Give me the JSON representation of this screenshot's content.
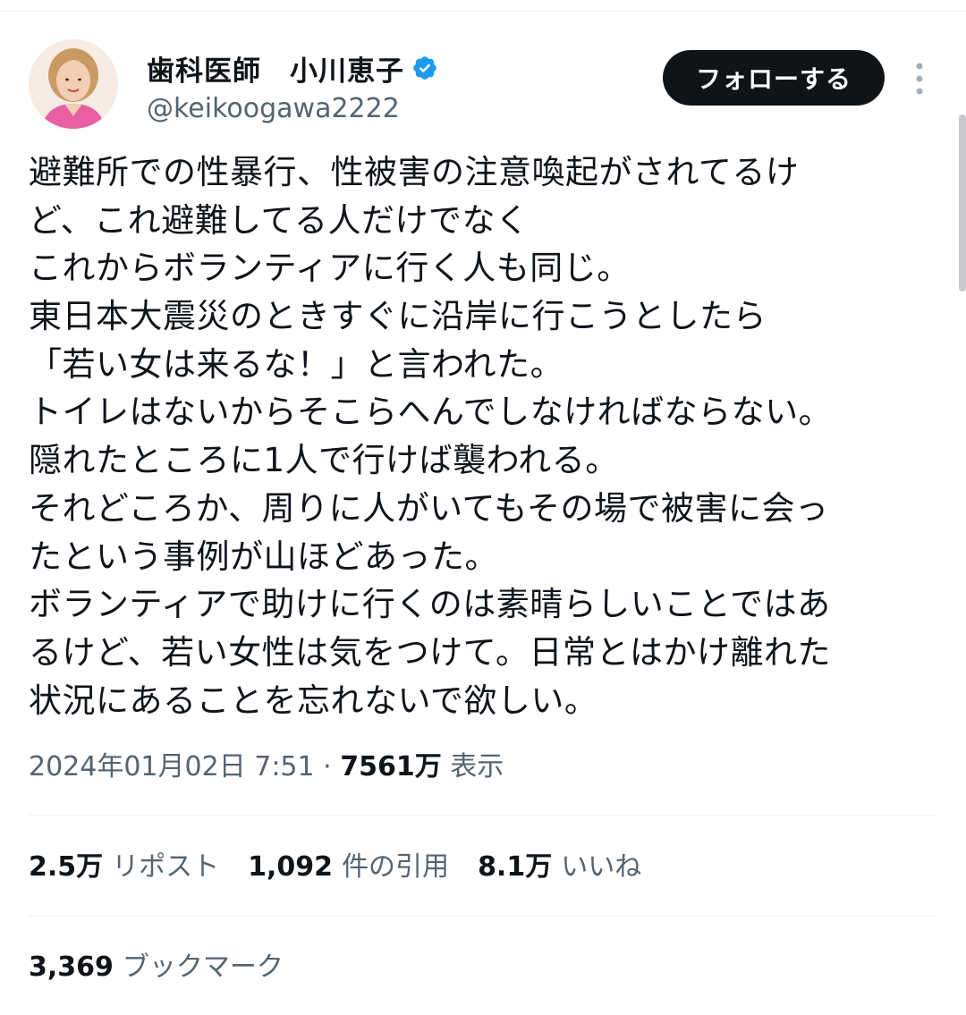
{
  "tweet": {
    "author": {
      "display_name": "歯科医師　小川恵子",
      "handle": "@keikoogawa2222",
      "verified": true
    },
    "follow_label": "フォローする",
    "body_lines": [
      "避難所での性暴行、性被害の注意喚起がされてるけ",
      "ど、これ避難してる人だけでなく",
      "これからボランティアに行く人も同じ。",
      "東日本大震災のときすぐに沿岸に行こうとしたら",
      "「若い女は来るな！」と言われた。",
      "トイレはないからそこらへんでしなければならない。",
      "隠れたところに1人で行けば襲われる。",
      "それどころか、周りに人がいてもその場で被害に会っ",
      "たという事例が山ほどあった。",
      "ボランティアで助けに行くのは素晴らしいことではあ",
      "るけど、若い女性は気をつけて。日常とはかけ離れた",
      "状況にあることを忘れないで欲しい。"
    ],
    "timestamp": "2024年01月02日 7:51",
    "separator": " · ",
    "views_count": "7561万",
    "views_label": " 表示",
    "stats": {
      "reposts": {
        "count": "2.5万",
        "label": "リポスト"
      },
      "quotes": {
        "count": "1,092",
        "label": "件の引用"
      },
      "likes": {
        "count": "8.1万",
        "label": "いいね"
      },
      "bookmarks": {
        "count": "3,369",
        "label": "ブックマーク"
      }
    }
  },
  "colors": {
    "text_primary": "#0f1419",
    "text_secondary": "#536471",
    "verified_blue": "#1d9bf0",
    "divider": "#eff3f4",
    "button_bg": "#0f1419"
  },
  "icons": {
    "verified": "verified-badge-icon",
    "more": "more-vertical-icon",
    "avatar": "profile-photo"
  }
}
